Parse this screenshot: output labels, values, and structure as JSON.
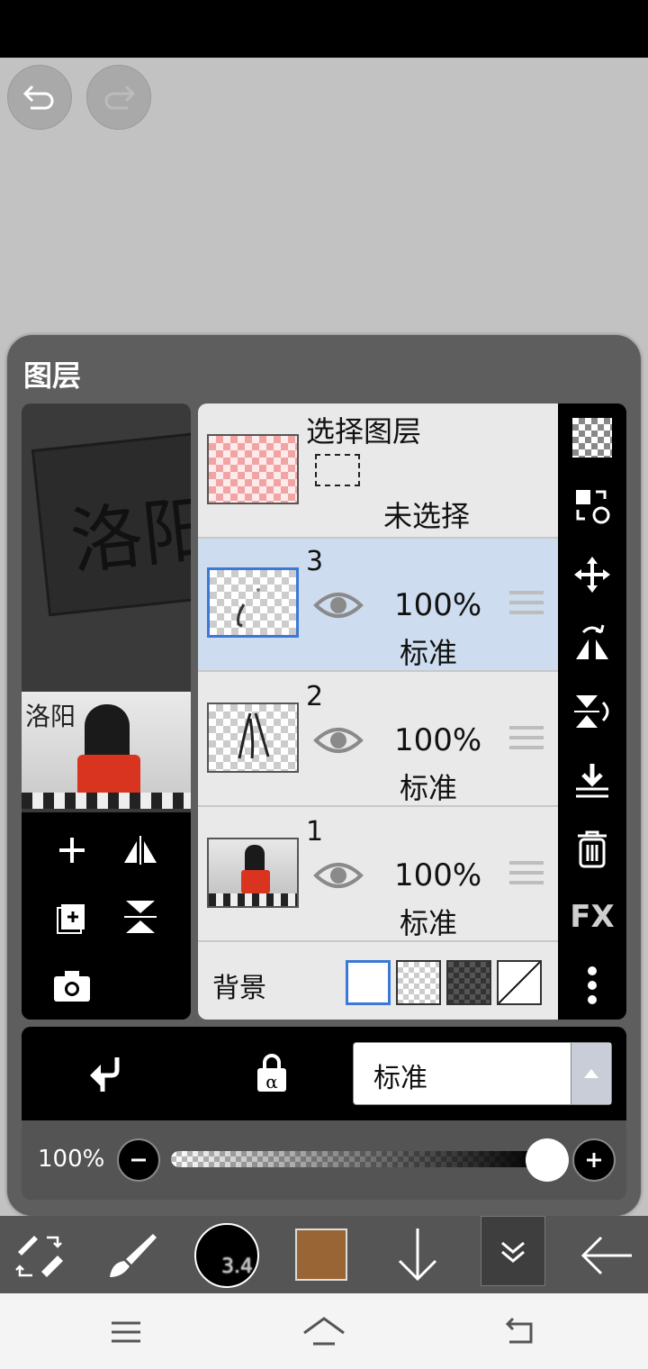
{
  "panel": {
    "title": "图层"
  },
  "selection_row": {
    "title": "选择图层",
    "status": "未选择"
  },
  "layers": [
    {
      "number": "3",
      "opacity": "100%",
      "mode": "标准",
      "selected": true
    },
    {
      "number": "2",
      "opacity": "100%",
      "mode": "标准",
      "selected": false
    },
    {
      "number": "1",
      "opacity": "100%",
      "mode": "标准",
      "selected": false
    }
  ],
  "background_row": {
    "label": "背景"
  },
  "preview": {
    "watermark_text": "洛阳"
  },
  "blend": {
    "mode_value": "标准"
  },
  "opacity": {
    "label": "100%",
    "level": 1.0
  },
  "toolbar": {
    "brush_size": "3.4",
    "color": "#9a6535"
  },
  "colors": {
    "accent": "#3b78d8",
    "selected_row": "#cddcee",
    "panel": "#5e5e5e"
  },
  "icons": {
    "undo": "undo-icon",
    "redo": "redo-icon",
    "checker": "transparency-icon",
    "fx": "FX",
    "right_icons": [
      "transparency-icon",
      "transform-swap-icon",
      "move-icon",
      "flip-horizontal-icon",
      "flip-vertical-icon",
      "merge-down-icon",
      "trash-icon",
      "fx-icon",
      "more-icon"
    ]
  },
  "right_fx_label": "FX"
}
